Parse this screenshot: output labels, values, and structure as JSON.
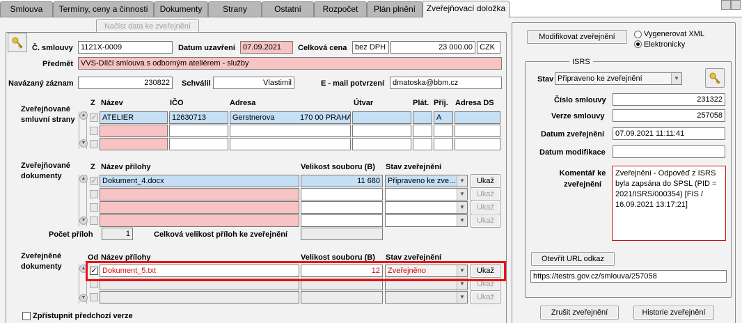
{
  "tabs": [
    {
      "label": "Smlouva"
    },
    {
      "label": "Termíny, ceny a činnosti"
    },
    {
      "label": "Dokumenty"
    },
    {
      "label": "Strany"
    },
    {
      "label": "Ostatní"
    },
    {
      "label": "Rozpočet"
    },
    {
      "label": "Plán plnění"
    },
    {
      "label": "Zveřejňovací doložka"
    }
  ],
  "header": {
    "load_button": "Načíst data ke zveřejnění",
    "contract_no_label": "Č. smlouvy",
    "contract_no": "1121X-0009",
    "date_label": "Datum uzavření",
    "date": "07.09.2021",
    "price_label": "Celková cena",
    "price_type": "bez DPH",
    "price": "23 000.00",
    "currency": "CZK",
    "subject_label": "Předmět",
    "subject": "VVS-Dílčí smlouva s odborným ateliérem - služby",
    "linked_label": "Navázaný záznam",
    "linked": "230822",
    "approved_label": "Schválil",
    "approved": "Vlastimil",
    "email_label": "E - mail potvrzení",
    "email": "dmatoska@bbm.cz"
  },
  "parties": {
    "section_label": "Zveřejňované smluvní strany",
    "col_z": "Z",
    "col_name": "Název",
    "col_ico": "IČO",
    "col_address": "Adresa",
    "col_unit": "Útvar",
    "col_plat": "Plát.",
    "col_prij": "Příj.",
    "col_ds": "Adresa DS",
    "row1_name": "ATELIER",
    "row1_ico": "12630713",
    "row1_street": "Gerstnerova",
    "row1_city": "170 00 PRAHA",
    "row1_prij": "A"
  },
  "documents": {
    "section_label": "Zveřejňované dokumenty",
    "col_z": "Z",
    "col_name": "Název přílohy",
    "col_size": "Velikost souboru (B)",
    "col_state": "Stav zveřejnění",
    "row1_name": "Dokument_4.docx",
    "row1_size": "11 680",
    "row1_state": "Připraveno ke zve...",
    "show_button": "Ukaž",
    "count_label": "Počet příloh",
    "count": "1",
    "total_label": "Celková velikost příloh ke zveřejnění"
  },
  "published": {
    "section_label": "Zveřejněné dokumenty",
    "col_od": "Od",
    "col_name": "Název přílohy",
    "col_size": "Velikost souboru (B)",
    "col_state": "Stav zveřejnění",
    "row1_name": "Dokument_5.txt",
    "row1_size": "12",
    "row1_state": "Zveřejněno",
    "show_button": "Ukaž"
  },
  "prev_version_label": "Zpřístupnit předchozí verze",
  "right": {
    "modify_button": "Modifikovat zveřejnění",
    "radio1": "Vygenerovat XML",
    "radio2": "Elektronicky",
    "isrs_title": "ISRS",
    "state_label": "Stav",
    "state_value": "Připraveno ke zveřejnění",
    "contract_no_label": "Číslo smlouvy",
    "contract_no": "231322",
    "version_label": "Verze smlouvy",
    "version": "257058",
    "pub_date_label": "Datum zveřejnění",
    "pub_date": "07.09.2021 11:11:41",
    "mod_date_label": "Datum modifikace",
    "comment_label": "Komentář ke zveřejnění",
    "comment": "Zveřejnění - Odpověď z ISRS byla zapsána do SPSL (PID = 2021/ISRS/000354) [FIS / 16.09.2021 13:17:21]",
    "url_button": "Otevřít URL odkaz",
    "url": "https://testrs.gov.cz/smlouva/257058",
    "cancel_button": "Zrušit zveřejnění",
    "history_button": "Historie zveřejnění"
  },
  "colors": {
    "pink": "#f7c3c3",
    "blue": "#c5dff5",
    "highlight": "#ee1111",
    "panel": "#f2f2f2"
  }
}
